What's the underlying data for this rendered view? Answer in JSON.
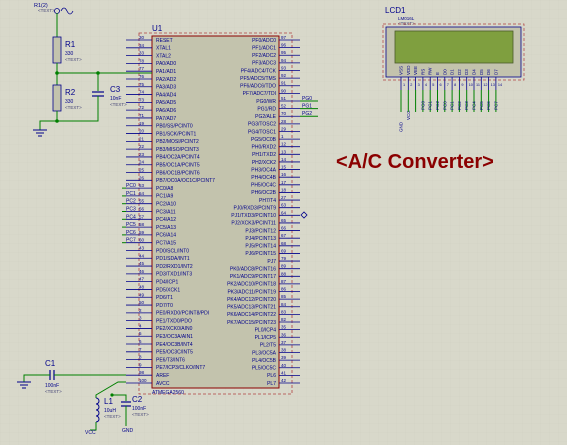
{
  "colors": {
    "background": "#d8d8ca",
    "grid": "#c8c8b8",
    "chip_fill": "#c3c3ad",
    "chip_border": "#8b0000",
    "wire": "#008000",
    "component": "#00008b",
    "text": "#00008b",
    "lcd_screen": "#7f9f3f",
    "title": "#8b0000"
  },
  "title": "<A/C Converter>",
  "chip": {
    "ref": "U1",
    "part": "ATMEGA2560",
    "left_pins": [
      {
        "num": "30",
        "name": "RESET"
      },
      {
        "num": "34",
        "name": "XTAL1"
      },
      {
        "num": "33",
        "name": "XTAL2"
      },
      {
        "num": "78",
        "name": "PA0/AD0"
      },
      {
        "num": "77",
        "name": "PA1/AD1"
      },
      {
        "num": "76",
        "name": "PA2/AD2"
      },
      {
        "num": "75",
        "name": "PA3/AD3"
      },
      {
        "num": "74",
        "name": "PA4/AD4"
      },
      {
        "num": "73",
        "name": "PA5/AD5"
      },
      {
        "num": "72",
        "name": "PA6/AD6"
      },
      {
        "num": "71",
        "name": "PA7/AD7"
      },
      {
        "num": "19",
        "name": "PB0/SS/PCINT0"
      },
      {
        "num": "20",
        "name": "PB1/SCK/PCINT1"
      },
      {
        "num": "21",
        "name": "PB2/MOSI/PCINT2"
      },
      {
        "num": "22",
        "name": "PB3/MISO/PCINT3"
      },
      {
        "num": "23",
        "name": "PB4/OC2A/PCINT4"
      },
      {
        "num": "24",
        "name": "PB5/OC1A/PCINT5"
      },
      {
        "num": "25",
        "name": "PB6/OC1B/PCINT6"
      },
      {
        "num": "26",
        "name": "PB7/OC0A/OC1C/PCINT7"
      },
      {
        "num": "53",
        "name": "PC0/A8"
      },
      {
        "num": "54",
        "name": "PC1/A9"
      },
      {
        "num": "55",
        "name": "PC2/A10"
      },
      {
        "num": "56",
        "name": "PC3/A11"
      },
      {
        "num": "57",
        "name": "PC4/A12"
      },
      {
        "num": "58",
        "name": "PC5/A13"
      },
      {
        "num": "59",
        "name": "PC6/A14"
      },
      {
        "num": "60",
        "name": "PC7/A15"
      },
      {
        "num": "43",
        "name": "PD0/SCL/INT0"
      },
      {
        "num": "44",
        "name": "PD1/SDA/INT1"
      },
      {
        "num": "45",
        "name": "PD2/RXD1/INT2"
      },
      {
        "num": "46",
        "name": "PD3/TXD1/INT3"
      },
      {
        "num": "47",
        "name": "PD4/ICP1"
      },
      {
        "num": "48",
        "name": "PD5/XCK1"
      },
      {
        "num": "49",
        "name": "PD6/T1"
      },
      {
        "num": "50",
        "name": "PD7/T0"
      },
      {
        "num": "2",
        "name": "PE0/RXD0/PCINT8/PDI"
      },
      {
        "num": "3",
        "name": "PE1/TXD0/PDO"
      },
      {
        "num": "4",
        "name": "PE2/XCK0/AIN0"
      },
      {
        "num": "5",
        "name": "PE3/OC3A/AIN1"
      },
      {
        "num": "6",
        "name": "PE4/OC3B/INT4"
      },
      {
        "num": "7",
        "name": "PE5/OC3C/INT5"
      },
      {
        "num": "8",
        "name": "PE6/T3/INT6"
      },
      {
        "num": "9",
        "name": "PE7/ICP3/CLKO/INT7"
      },
      {
        "num": "98",
        "name": "AREF"
      },
      {
        "num": "100",
        "name": "AVCC"
      }
    ],
    "right_pins": [
      {
        "num": "97",
        "name": "PF0/ADC0"
      },
      {
        "num": "96",
        "name": "PF1/ADC1"
      },
      {
        "num": "95",
        "name": "PF2/ADC2"
      },
      {
        "num": "94",
        "name": "PF3/ADC3"
      },
      {
        "num": "93",
        "name": "PF4/ADC4/TCK"
      },
      {
        "num": "92",
        "name": "PF5/ADC5/TMS"
      },
      {
        "num": "91",
        "name": "PF6/ADC6/TDO"
      },
      {
        "num": "90",
        "name": "PF7/ADC7/TDI"
      },
      {
        "num": "51",
        "name": "PG0/WR"
      },
      {
        "num": "52",
        "name": "PG1/RD"
      },
      {
        "num": "70",
        "name": "PG2/ALE"
      },
      {
        "num": "28",
        "name": "PG3/TOSC2"
      },
      {
        "num": "29",
        "name": "PG4/TOSC1"
      },
      {
        "num": "1",
        "name": "PG5/OC0B"
      },
      {
        "num": "12",
        "name": "PH0/RXD2"
      },
      {
        "num": "13",
        "name": "PH1/TXD2"
      },
      {
        "num": "14",
        "name": "PH2/XCK2"
      },
      {
        "num": "15",
        "name": "PH3/OC4A"
      },
      {
        "num": "16",
        "name": "PH4/OC4B"
      },
      {
        "num": "17",
        "name": "PH5/OC4C"
      },
      {
        "num": "18",
        "name": "PH6/OC2B"
      },
      {
        "num": "27",
        "name": "PH7/T4"
      },
      {
        "num": "63",
        "name": "PJ0/RXD3/PCINT9"
      },
      {
        "num": "64",
        "name": "PJ1/TXD3/PCINT10"
      },
      {
        "num": "65",
        "name": "PJ2/XCK3/PCINT11"
      },
      {
        "num": "66",
        "name": "PJ3/PCINT12"
      },
      {
        "num": "67",
        "name": "PJ4/PCINT13"
      },
      {
        "num": "68",
        "name": "PJ5/PCINT14"
      },
      {
        "num": "69",
        "name": "PJ6/PCINT15"
      },
      {
        "num": "79",
        "name": "PJ7"
      },
      {
        "num": "89",
        "name": "PK0/ADC8/PCINT16"
      },
      {
        "num": "88",
        "name": "PK1/ADC9/PCINT17"
      },
      {
        "num": "87",
        "name": "PK2/ADC10/PCINT18"
      },
      {
        "num": "86",
        "name": "PK3/ADC11/PCINT19"
      },
      {
        "num": "85",
        "name": "PK4/ADC12/PCINT20"
      },
      {
        "num": "84",
        "name": "PK5/ADC13/PCINT21"
      },
      {
        "num": "83",
        "name": "PK6/ADC14/PCINT22"
      },
      {
        "num": "82",
        "name": "PK7/ADC15/PCINT23"
      },
      {
        "num": "35",
        "name": "PL0/ICP4"
      },
      {
        "num": "36",
        "name": "PL1/ICP5"
      },
      {
        "num": "37",
        "name": "PL2/T5"
      },
      {
        "num": "38",
        "name": "PL3/OC5A"
      },
      {
        "num": "39",
        "name": "PL4/OC5B"
      },
      {
        "num": "40",
        "name": "PL5/OC5C"
      },
      {
        "num": "41",
        "name": "PL6"
      },
      {
        "num": "42",
        "name": "PL7"
      }
    ],
    "net_labels_left": [
      "PC0",
      "PC1",
      "PC2",
      "PC3",
      "PC4",
      "PC5",
      "PC6",
      "PC7"
    ],
    "net_labels_right": [
      "PG0",
      "PG1",
      "PG2"
    ]
  },
  "components": {
    "R1": {
      "ref": "R1",
      "value": "330",
      "text": "<TEXT>"
    },
    "R2": {
      "ref": "R2",
      "value": "330",
      "text": "<TEXT>"
    },
    "C3": {
      "ref": "C3",
      "value": "10nF",
      "text": "<TEXT>"
    },
    "C1": {
      "ref": "C1",
      "value": "100nF",
      "text": "<TEXT>"
    },
    "C2": {
      "ref": "C2",
      "value": "100nF",
      "text": "<TEXT>"
    },
    "L1": {
      "ref": "L1",
      "value": "10uH",
      "text": "<TEXT>"
    },
    "source": {
      "ref": "R1(2)",
      "text": "<TEXT>"
    },
    "gnd_label": "GND",
    "vcc_label": "VCC"
  },
  "lcd": {
    "ref": "LCD1",
    "part": "LM016L",
    "text": "<TEXT>",
    "pins": [
      "VSS",
      "VDD",
      "VEE",
      "RS",
      "RW",
      "E",
      "D0",
      "D1",
      "D2",
      "D3",
      "D4",
      "D5",
      "D6",
      "D7"
    ],
    "nets": [
      "PG0",
      "PG1",
      "PG2",
      "PC0",
      "PC1",
      "PC2",
      "PC3",
      "PC4",
      "PC5",
      "PC6",
      "PC7"
    ],
    "gnd": "GND",
    "vcc": "VCC"
  }
}
